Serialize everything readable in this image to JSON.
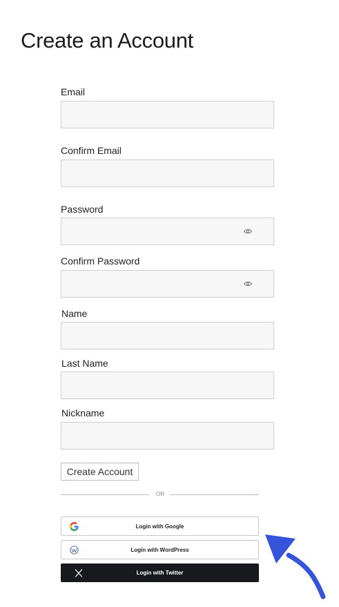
{
  "page": {
    "title": "Create an Account"
  },
  "form": {
    "fields": [
      {
        "label": "Email",
        "value": ""
      },
      {
        "label": "Confirm Email",
        "value": ""
      },
      {
        "label": "Password",
        "value": ""
      },
      {
        "label": "Confirm Password",
        "value": ""
      },
      {
        "label": "Name",
        "value": ""
      },
      {
        "label": "Last Name",
        "value": ""
      },
      {
        "label": "Nickname",
        "value": ""
      }
    ],
    "submit_label": "Create Account"
  },
  "divider": {
    "text": "OR"
  },
  "social": {
    "google": "Login with Google",
    "wordpress": "Login with WordPress",
    "twitter": "Login with Twitter"
  },
  "colors": {
    "arrow": "#3554d9",
    "twitter_bg": "#17191c",
    "input_bg": "#f7f7f7"
  },
  "icons": [
    "eye-icon",
    "google-icon",
    "wordpress-icon",
    "x-icon",
    "arrow-annotation"
  ]
}
